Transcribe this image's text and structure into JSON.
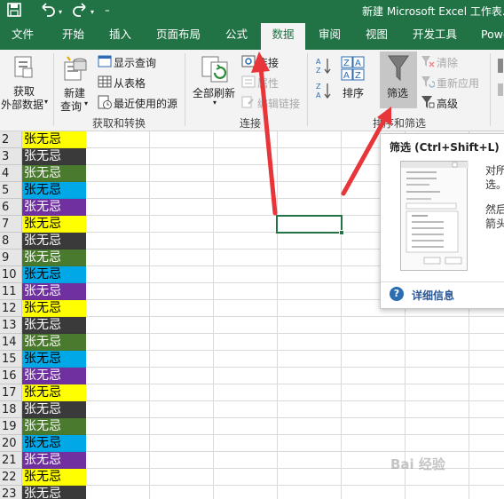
{
  "window": {
    "title": "新建 Microsoft Excel 工作表..."
  },
  "quick_access": {
    "save_icon": "save-icon",
    "undo_icon": "undo-icon",
    "redo_icon": "redo-icon",
    "customize_icon": "customize-icon"
  },
  "tabs": [
    {
      "label": "文件"
    },
    {
      "label": "开始"
    },
    {
      "label": "插入"
    },
    {
      "label": "页面布局"
    },
    {
      "label": "公式"
    },
    {
      "label": "数据"
    },
    {
      "label": "审阅"
    },
    {
      "label": "视图"
    },
    {
      "label": "开发工具"
    },
    {
      "label": "Powe"
    }
  ],
  "active_tab": "数据",
  "ribbon": {
    "get_external": {
      "line1": "获取",
      "line2": "外部数据",
      "arrow": "▾"
    },
    "new_query": {
      "line1": "新建",
      "line2": "查询",
      "arrow": "▾"
    },
    "show_queries": "显示查询",
    "from_table": "从表格",
    "recent_sources": "最近使用的源",
    "group_get": "获取和转换",
    "refresh_all": {
      "line1": "全部刷新",
      "arrow": "▾"
    },
    "connections": "连接",
    "properties": "属性",
    "edit_links": "编辑链接",
    "group_connections": "连接",
    "sort": "排序",
    "filter": "筛选",
    "clear": "清除",
    "reapply": "重新应用",
    "advanced": "高级",
    "group_sort": "排序和筛选"
  },
  "sheet": {
    "rows": [
      {
        "num": "2",
        "value": "张无忌",
        "color": "#ffff00"
      },
      {
        "num": "3",
        "value": "张无忌",
        "color": "#3a3a3a"
      },
      {
        "num": "4",
        "value": "张无忌",
        "color": "#4a7a2e"
      },
      {
        "num": "5",
        "value": "张无忌",
        "color": "#00a8e8"
      },
      {
        "num": "6",
        "value": "张无忌",
        "color": "#7030a0"
      },
      {
        "num": "7",
        "value": "张无忌",
        "color": "#ffff00"
      },
      {
        "num": "8",
        "value": "张无忌",
        "color": "#3a3a3a"
      },
      {
        "num": "9",
        "value": "张无忌",
        "color": "#4a7a2e"
      },
      {
        "num": "10",
        "value": "张无忌",
        "color": "#00a8e8"
      },
      {
        "num": "11",
        "value": "张无忌",
        "color": "#7030a0"
      },
      {
        "num": "12",
        "value": "张无忌",
        "color": "#ffff00"
      },
      {
        "num": "13",
        "value": "张无忌",
        "color": "#3a3a3a"
      },
      {
        "num": "14",
        "value": "张无忌",
        "color": "#4a7a2e"
      },
      {
        "num": "15",
        "value": "张无忌",
        "color": "#00a8e8"
      },
      {
        "num": "16",
        "value": "张无忌",
        "color": "#7030a0"
      },
      {
        "num": "17",
        "value": "张无忌",
        "color": "#ffff00"
      },
      {
        "num": "18",
        "value": "张无忌",
        "color": "#3a3a3a"
      },
      {
        "num": "19",
        "value": "张无忌",
        "color": "#4a7a2e"
      },
      {
        "num": "20",
        "value": "张无忌",
        "color": "#00a8e8"
      },
      {
        "num": "21",
        "value": "张无忌",
        "color": "#7030a0"
      },
      {
        "num": "22",
        "value": "张无忌",
        "color": "#ffff00"
      },
      {
        "num": "23",
        "value": "张无忌",
        "color": "#3a3a3a"
      }
    ]
  },
  "tooltip": {
    "title": "筛选 (Ctrl+Shift+L)",
    "text1": "对所",
    "text2": "选。",
    "text3": "然后",
    "text4": "箭头",
    "more_info": "详细信息"
  },
  "watermark": "Bai 经验",
  "colors": {
    "excel_green": "#217346",
    "arrow_red": "#e8353a",
    "selection_border": "#217346"
  }
}
